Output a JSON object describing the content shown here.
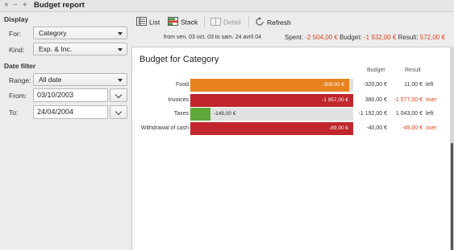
{
  "window": {
    "title": "Budget report",
    "controls": {
      "close": "×",
      "minimize": "−",
      "maximize": "+"
    }
  },
  "sidebar": {
    "display_heading": "Display",
    "for_label": "For:",
    "for_value": "Category",
    "kind_label": "Kind:",
    "kind_value": "Exp. & Inc.",
    "date_filter_heading": "Date filter",
    "range_label": "Range:",
    "range_value": "All date",
    "from_label": "From:",
    "from_value": "03/10/2003",
    "to_label": "To:",
    "to_value": "24/04/2004"
  },
  "toolbar": {
    "list_label": "List",
    "stack_label": "Stack",
    "detail_label": "Detail",
    "refresh_label": "Refresh",
    "date_range": "from ven. 03 oct. 03 to sam. 24 avril 04",
    "spent_label": "Spent:",
    "spent_value": "-2 504,00 €",
    "budget_label": "Budget:",
    "budget_value": "-1 932,00 €",
    "result_label": "Result:",
    "result_value": "572,00 €"
  },
  "report": {
    "title": "Budget for Category",
    "col_budget": "Budget",
    "col_result": "Result",
    "rows": [
      {
        "name": "Food",
        "spent": "-309,00 €",
        "budget": "-320,00 €",
        "result": "11,00 €",
        "status": "left",
        "fill": 0.975,
        "color": "#e8821e",
        "over": false
      },
      {
        "name": "Invoices",
        "spent": "-1 957,00 €",
        "budget": "380,00 €",
        "result": "-1 577,00 €",
        "status": "over",
        "fill": 1.0,
        "color": "#c0262c",
        "over": true
      },
      {
        "name": "Taxes",
        "spent": "-149,00 €",
        "budget": "-1 192,00 €",
        "result": "1 043,00 €",
        "status": "left",
        "fill": 0.125,
        "color": "#5fa83a",
        "over": false
      },
      {
        "name": "Withdrawal of cash",
        "spent": "-89,00 €",
        "budget": "-40,00 €",
        "result": "-49,00 €",
        "status": "over",
        "fill": 1.0,
        "color": "#c0262c",
        "over": true
      }
    ]
  },
  "colors": {
    "negative": "#e0421c",
    "over_bar": "#c0262c",
    "food_bar": "#e8821e",
    "taxes_bar": "#5fa83a"
  }
}
